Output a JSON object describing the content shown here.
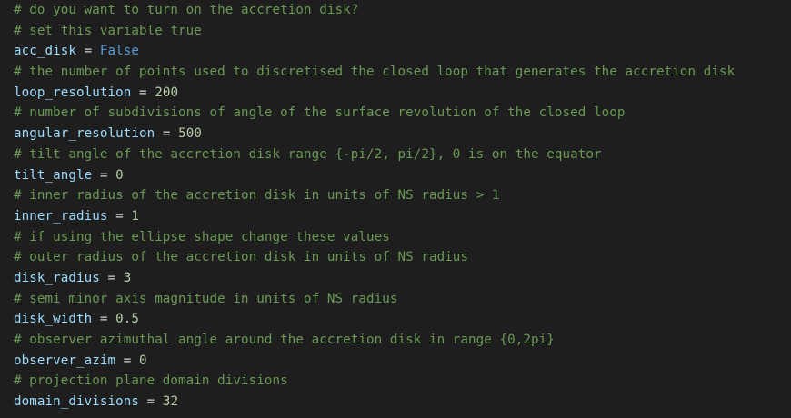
{
  "lines": [
    {
      "type": "comment",
      "text": "# do you want to turn on the accretion disk?"
    },
    {
      "type": "comment",
      "text": "# set this variable true"
    },
    {
      "type": "assign",
      "name": "acc_disk",
      "op": " = ",
      "value": "False",
      "value_kind": "keyword"
    },
    {
      "type": "comment",
      "text": "# the number of points used to discretised the closed loop that generates the accretion disk"
    },
    {
      "type": "assign",
      "name": "loop_resolution",
      "op": " = ",
      "value": "200",
      "value_kind": "number"
    },
    {
      "type": "comment",
      "text": "# number of subdivisions of angle of the surface revolution of the closed loop"
    },
    {
      "type": "assign",
      "name": "angular_resolution",
      "op": " = ",
      "value": "500",
      "value_kind": "number"
    },
    {
      "type": "comment",
      "text": "# tilt angle of the accretion disk range {-pi/2, pi/2}, 0 is on the equator"
    },
    {
      "type": "assign",
      "name": "tilt_angle",
      "op": " = ",
      "value": "0",
      "value_kind": "number"
    },
    {
      "type": "comment",
      "text": "# inner radius of the accretion disk in units of NS radius > 1"
    },
    {
      "type": "assign",
      "name": "inner_radius",
      "op": " = ",
      "value": "1",
      "value_kind": "number"
    },
    {
      "type": "comment",
      "text": "# if using the ellipse shape change these values"
    },
    {
      "type": "comment",
      "text": "# outer radius of the accretion disk in units of NS radius"
    },
    {
      "type": "assign",
      "name": "disk_radius",
      "op": " = ",
      "value": "3",
      "value_kind": "number"
    },
    {
      "type": "comment",
      "text": "# semi minor axis magnitude in units of NS radius"
    },
    {
      "type": "assign",
      "name": "disk_width",
      "op": " = ",
      "value": "0.5",
      "value_kind": "number"
    },
    {
      "type": "comment",
      "text": "# observer azimuthal angle around the accretion disk in range {0,2pi}"
    },
    {
      "type": "assign",
      "name": "observer_azim",
      "op": " = ",
      "value": "0",
      "value_kind": "number"
    },
    {
      "type": "comment",
      "text": "# projection plane domain divisions"
    },
    {
      "type": "assign",
      "name": "domain_divisions",
      "op": " = ",
      "value": "32",
      "value_kind": "number"
    }
  ],
  "colors": {
    "background": "#1e1e1e",
    "comment": "#6a9955",
    "variable": "#9cdcfe",
    "operator": "#d4d4d4",
    "number": "#b5cea8",
    "keyword": "#569cd6"
  }
}
